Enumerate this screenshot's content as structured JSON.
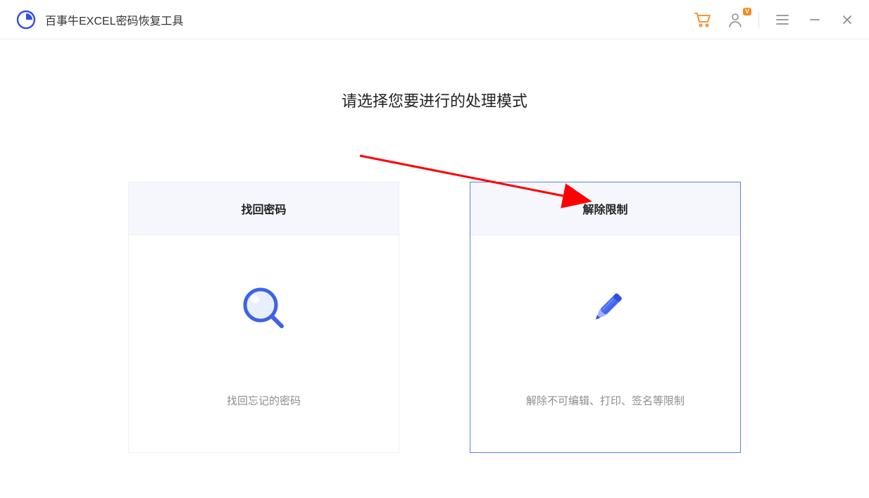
{
  "app": {
    "title": "百事牛EXCEL密码恢复工具"
  },
  "titlebar": {
    "cart_icon": "cart-icon",
    "user_icon": "user-icon",
    "vip_badge": "V",
    "menu_icon": "menu-icon",
    "minimize_icon": "minimize-icon",
    "close_icon": "close-icon"
  },
  "main": {
    "heading": "请选择您要进行的处理模式"
  },
  "cards": {
    "recover": {
      "title": "找回密码",
      "desc": "找回忘记的密码",
      "icon": "magnifier-icon"
    },
    "unlock": {
      "title": "解除限制",
      "desc": "解除不可编辑、打印、签名等限制",
      "icon": "pencil-icon"
    }
  },
  "colors": {
    "accent": "#5b7ff0",
    "accent_dark": "#2f4fe0",
    "cart": "#f58a1f"
  }
}
